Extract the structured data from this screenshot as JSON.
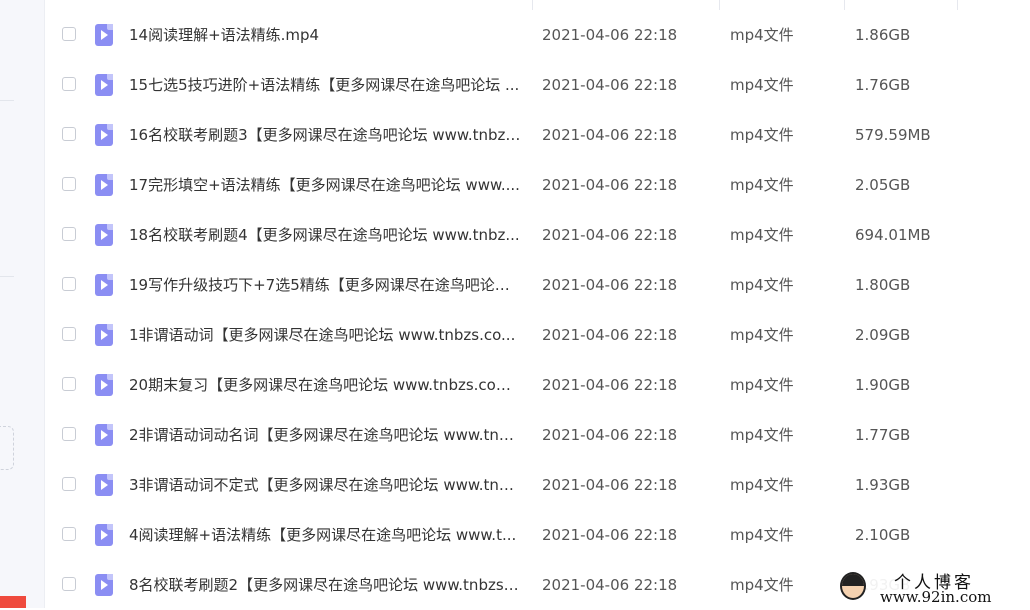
{
  "files": [
    {
      "name": "14阅读理解+语法精练.mp4",
      "date": "2021-04-06 22:18",
      "type": "mp4文件",
      "size": "1.86GB"
    },
    {
      "name": "15七选5技巧进阶+语法精练【更多网课尽在途鸟吧论坛 ...",
      "date": "2021-04-06 22:18",
      "type": "mp4文件",
      "size": "1.76GB"
    },
    {
      "name": "16名校联考刷题3【更多网课尽在途鸟吧论坛 www.tnbzs...",
      "date": "2021-04-06 22:18",
      "type": "mp4文件",
      "size": "579.59MB"
    },
    {
      "name": "17完形填空+语法精练【更多网课尽在途鸟吧论坛 www....",
      "date": "2021-04-06 22:18",
      "type": "mp4文件",
      "size": "2.05GB"
    },
    {
      "name": "18名校联考刷题4【更多网课尽在途鸟吧论坛 www.tnbz...",
      "date": "2021-04-06 22:18",
      "type": "mp4文件",
      "size": "694.01MB"
    },
    {
      "name": "19写作升级技巧下+7选5精练【更多网课尽在途鸟吧论坛...",
      "date": "2021-04-06 22:18",
      "type": "mp4文件",
      "size": "1.80GB"
    },
    {
      "name": "1非谓语动词【更多网课尽在途鸟吧论坛 www.tnbzs.co...",
      "date": "2021-04-06 22:18",
      "type": "mp4文件",
      "size": "2.09GB"
    },
    {
      "name": "20期末复习【更多网课尽在途鸟吧论坛 www.tnbzs.com...",
      "date": "2021-04-06 22:18",
      "type": "mp4文件",
      "size": "1.90GB"
    },
    {
      "name": "2非谓语动词动名词【更多网课尽在途鸟吧论坛 www.tnb...",
      "date": "2021-04-06 22:18",
      "type": "mp4文件",
      "size": "1.77GB"
    },
    {
      "name": "3非谓语动词不定式【更多网课尽在途鸟吧论坛 www.tnb...",
      "date": "2021-04-06 22:18",
      "type": "mp4文件",
      "size": "1.93GB"
    },
    {
      "name": "4阅读理解+语法精练【更多网课尽在途鸟吧论坛 www.t...",
      "date": "2021-04-06 22:18",
      "type": "mp4文件",
      "size": "2.10GB"
    },
    {
      "name": "8名校联考刷题2【更多网课尽在途鸟吧论坛 www.tnbzs....",
      "date": "2021-04-06 22:18",
      "type": "mp4文件",
      "size": "1.93GB"
    }
  ],
  "watermark": {
    "title": "个人博客",
    "url": "www.92in.com"
  },
  "colors": {
    "file_icon": "#8b8ef3",
    "accent_red": "#ef4a3d"
  },
  "icons": {
    "file": "video-file-icon",
    "checkbox": "checkbox"
  }
}
